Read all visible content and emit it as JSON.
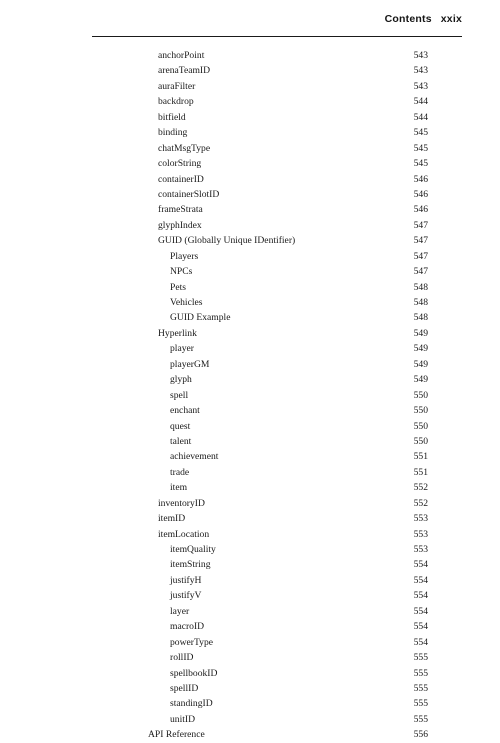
{
  "header": {
    "label": "Contents",
    "page_number": "xxix"
  },
  "toc": {
    "entries": [
      {
        "title": "anchorPoint",
        "page": "543",
        "level": 1
      },
      {
        "title": "arenaTeamID",
        "page": "543",
        "level": 1
      },
      {
        "title": "auraFilter",
        "page": "543",
        "level": 1
      },
      {
        "title": "backdrop",
        "page": "544",
        "level": 1
      },
      {
        "title": "bitfield",
        "page": "544",
        "level": 1
      },
      {
        "title": "binding",
        "page": "545",
        "level": 1
      },
      {
        "title": "chatMsgType",
        "page": "545",
        "level": 1
      },
      {
        "title": "colorString",
        "page": "545",
        "level": 1
      },
      {
        "title": "containerID",
        "page": "546",
        "level": 1
      },
      {
        "title": "containerSlotID",
        "page": "546",
        "level": 1
      },
      {
        "title": "frameStrata",
        "page": "546",
        "level": 1
      },
      {
        "title": "glyphIndex",
        "page": "547",
        "level": 1
      },
      {
        "title": "GUID (Globally Unique IDentifier)",
        "page": "547",
        "level": 1
      },
      {
        "title": "Players",
        "page": "547",
        "level": 2
      },
      {
        "title": "NPCs",
        "page": "547",
        "level": 2
      },
      {
        "title": "Pets",
        "page": "548",
        "level": 2
      },
      {
        "title": "Vehicles",
        "page": "548",
        "level": 2
      },
      {
        "title": "GUID Example",
        "page": "548",
        "level": 2
      },
      {
        "title": "Hyperlink",
        "page": "549",
        "level": 1
      },
      {
        "title": "player",
        "page": "549",
        "level": 2
      },
      {
        "title": "playerGM",
        "page": "549",
        "level": 2
      },
      {
        "title": "glyph",
        "page": "549",
        "level": 2
      },
      {
        "title": "spell",
        "page": "550",
        "level": 2
      },
      {
        "title": "enchant",
        "page": "550",
        "level": 2
      },
      {
        "title": "quest",
        "page": "550",
        "level": 2
      },
      {
        "title": "talent",
        "page": "550",
        "level": 2
      },
      {
        "title": "achievement",
        "page": "551",
        "level": 2
      },
      {
        "title": "trade",
        "page": "551",
        "level": 2
      },
      {
        "title": "item",
        "page": "552",
        "level": 2
      },
      {
        "title": "inventoryID",
        "page": "552",
        "level": 1
      },
      {
        "title": "itemID",
        "page": "553",
        "level": 1
      },
      {
        "title": "itemLocation",
        "page": "553",
        "level": 1
      },
      {
        "title": "itemQuality",
        "page": "553",
        "level": 2
      },
      {
        "title": "itemString",
        "page": "554",
        "level": 2
      },
      {
        "title": "justifyH",
        "page": "554",
        "level": 2
      },
      {
        "title": "justifyV",
        "page": "554",
        "level": 2
      },
      {
        "title": "layer",
        "page": "554",
        "level": 2
      },
      {
        "title": "macroID",
        "page": "554",
        "level": 2
      },
      {
        "title": "powerType",
        "page": "554",
        "level": 2
      },
      {
        "title": "rollID",
        "page": "555",
        "level": 2
      },
      {
        "title": "spellbookID",
        "page": "555",
        "level": 2
      },
      {
        "title": "spellID",
        "page": "555",
        "level": 2
      },
      {
        "title": "standingID",
        "page": "555",
        "level": 2
      },
      {
        "title": "unitID",
        "page": "555",
        "level": 2
      },
      {
        "title": "API Reference",
        "page": "556",
        "level": 0
      }
    ]
  }
}
